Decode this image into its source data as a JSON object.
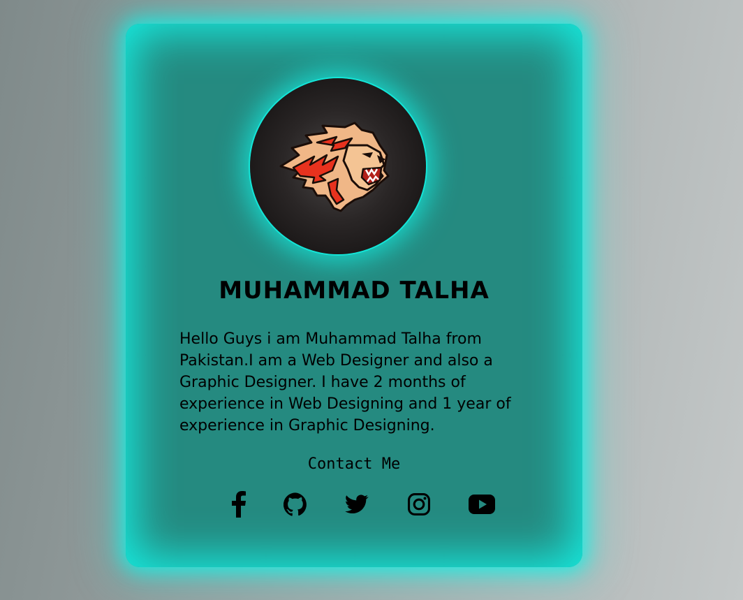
{
  "profile": {
    "name": "MUHAMMAD TALHA",
    "bio": "Hello Guys i am Muhammad Talha from Pakistan.I am a Web Designer and also a Graphic Designer. I have 2 months of experience in Web Designing and 1 year of experience in Graphic Designing.",
    "avatar_icon": "lion-logo-icon"
  },
  "contact": {
    "label": "Contact Me",
    "links": [
      {
        "icon": "facebook-icon"
      },
      {
        "icon": "github-icon"
      },
      {
        "icon": "twitter-icon"
      },
      {
        "icon": "instagram-icon"
      },
      {
        "icon": "youtube-icon"
      }
    ]
  },
  "colors": {
    "glow": "#16e8dc",
    "card": "#258a80",
    "text": "#000000"
  }
}
